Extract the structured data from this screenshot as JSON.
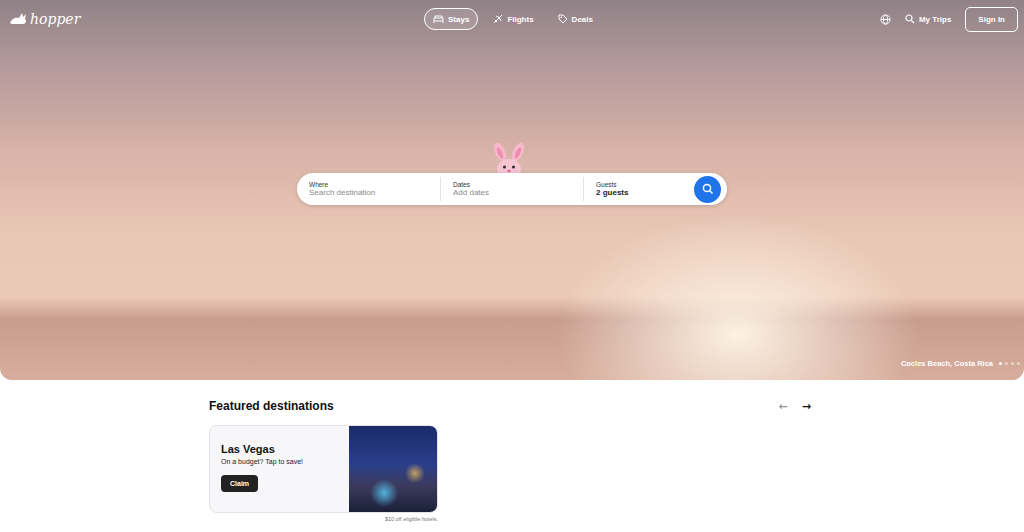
{
  "logo": {
    "text": "hopper"
  },
  "nav": {
    "tabs": [
      {
        "label": "Stays",
        "selected": true
      },
      {
        "label": "Flights",
        "selected": false
      },
      {
        "label": "Deals",
        "selected": false
      }
    ],
    "my_trips": "My Trips",
    "sign_in": "Sign In"
  },
  "hero": {
    "caption": "Cocles Beach, Costa Rica",
    "slides": [
      {
        "selected": true
      },
      {
        "selected": false
      },
      {
        "selected": false
      },
      {
        "selected": false
      }
    ]
  },
  "search": {
    "fields": [
      {
        "label": "Where",
        "value": "Search destination",
        "placeholder": true
      },
      {
        "label": "Dates",
        "value": "Add dates",
        "placeholder": true
      },
      {
        "label": "Guests",
        "value": "2 guests",
        "placeholder": false
      }
    ]
  },
  "featured": {
    "title": "Featured destinations",
    "prev": {
      "icon": "←",
      "disabled": true
    },
    "next": {
      "icon": "→",
      "disabled": false
    },
    "cards": [
      {
        "title": "Las Vegas",
        "subtitle": "On a budget? Tap to save!",
        "button": "Claim",
        "note": "$10 off eligible hotels."
      }
    ]
  }
}
